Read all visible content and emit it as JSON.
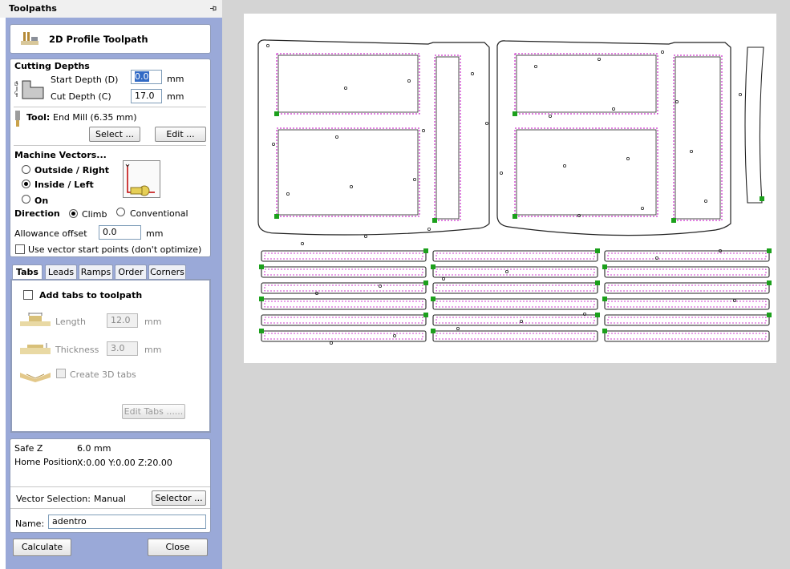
{
  "panel": {
    "title": "Toolpaths",
    "toolpath_title": "2D Profile Toolpath",
    "cutting_depths": {
      "heading": "Cutting Depths",
      "start_depth_label": "Start Depth (D)",
      "start_depth_value": "0.0",
      "cut_depth_label": "Cut Depth (C)",
      "cut_depth_value": "17.0",
      "unit": "mm"
    },
    "tool": {
      "label": "Tool:",
      "name": "End Mill (6.35 mm)",
      "select_label": "Select ...",
      "edit_label": "Edit ..."
    },
    "machine_vectors": {
      "heading": "Machine Vectors...",
      "outside": "Outside / Right",
      "inside": "Inside / Left",
      "on": "On",
      "selected": "Inside / Left"
    },
    "direction": {
      "label": "Direction",
      "climb": "Climb",
      "conventional": "Conventional",
      "selected": "Climb"
    },
    "allowance": {
      "label": "Allowance offset",
      "value": "0.0",
      "unit": "mm"
    },
    "vector_start": {
      "label": "Use vector start points (don't optimize)",
      "checked": false
    },
    "tabs_bar": [
      "Tabs",
      "Leads",
      "Ramps",
      "Order",
      "Corners"
    ],
    "tabs_section": {
      "add_tabs_label": "Add tabs to toolpath",
      "length_label": "Length",
      "length_value": "12.0",
      "thickness_label": "Thickness",
      "thickness_value": "3.0",
      "unit": "mm",
      "create_3d_label": "Create 3D tabs",
      "edit_tabs_label": "Edit Tabs ......"
    },
    "info": {
      "safe_z_label": "Safe Z",
      "safe_z_value": "6.0 mm",
      "home_label": "Home Position",
      "home_value": "X:0.00 Y:0.00 Z:20.00"
    },
    "vector_selection": {
      "label": "Vector Selection:",
      "value": "Manual",
      "selector_label": "Selector ..."
    },
    "name": {
      "label": "Name:",
      "value": "adentro"
    },
    "buttons": {
      "calculate": "Calculate",
      "close": "Close"
    }
  },
  "canvas": {
    "background": "#ffffff",
    "vector_color": "#222222",
    "toolpath_color": "#c000c0",
    "start_point_color": "#1ca01c"
  },
  "colors": {
    "panel_frame": "#9aa9d8",
    "viewport_background": "#d4d4d4"
  }
}
